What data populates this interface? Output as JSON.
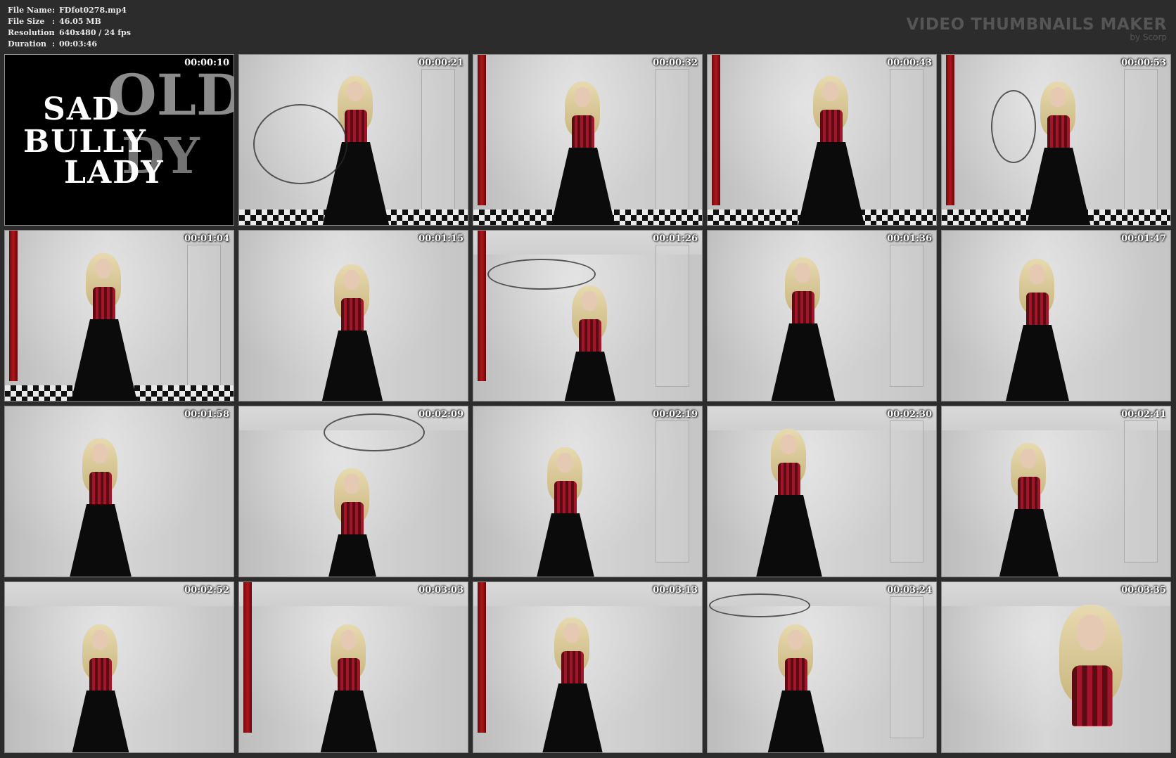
{
  "file_info": {
    "rows": [
      {
        "key": "File Name",
        "sep": ":",
        "value": "FDfot0278.mp4"
      },
      {
        "key": "File Size",
        "sep": ":",
        "value": "46.05 MB"
      },
      {
        "key": "Resolution",
        "sep": ":",
        "value": "640x480 / 24 fps"
      },
      {
        "key": "Duration",
        "sep": ":",
        "value": "00:03:46"
      }
    ]
  },
  "brand": {
    "title": "VIDEO THUMBNAILS MAKER",
    "subtitle": "by Scorp"
  },
  "title_card": {
    "line1": "SAD",
    "line2": "BULLY",
    "line3": "LADY",
    "overlay1": "OLD",
    "overlay2": "DY"
  },
  "thumbnails": [
    {
      "timestamp": "00:00:10"
    },
    {
      "timestamp": "00:00:21"
    },
    {
      "timestamp": "00:00:32"
    },
    {
      "timestamp": "00:00:43"
    },
    {
      "timestamp": "00:00:53"
    },
    {
      "timestamp": "00:01:04"
    },
    {
      "timestamp": "00:01:15"
    },
    {
      "timestamp": "00:01:26"
    },
    {
      "timestamp": "00:01:36"
    },
    {
      "timestamp": "00:01:47"
    },
    {
      "timestamp": "00:01:58"
    },
    {
      "timestamp": "00:02:09"
    },
    {
      "timestamp": "00:02:19"
    },
    {
      "timestamp": "00:02:30"
    },
    {
      "timestamp": "00:02:41"
    },
    {
      "timestamp": "00:02:52"
    },
    {
      "timestamp": "00:03:03"
    },
    {
      "timestamp": "00:03:13"
    },
    {
      "timestamp": "00:03:24"
    },
    {
      "timestamp": "00:03:35"
    }
  ],
  "colors": {
    "background": "#2c2c2c",
    "header_text": "#e8e8e8",
    "brand_text": "#555555",
    "corset_red": "#a3152a",
    "curtain_red": "#b3141b"
  }
}
